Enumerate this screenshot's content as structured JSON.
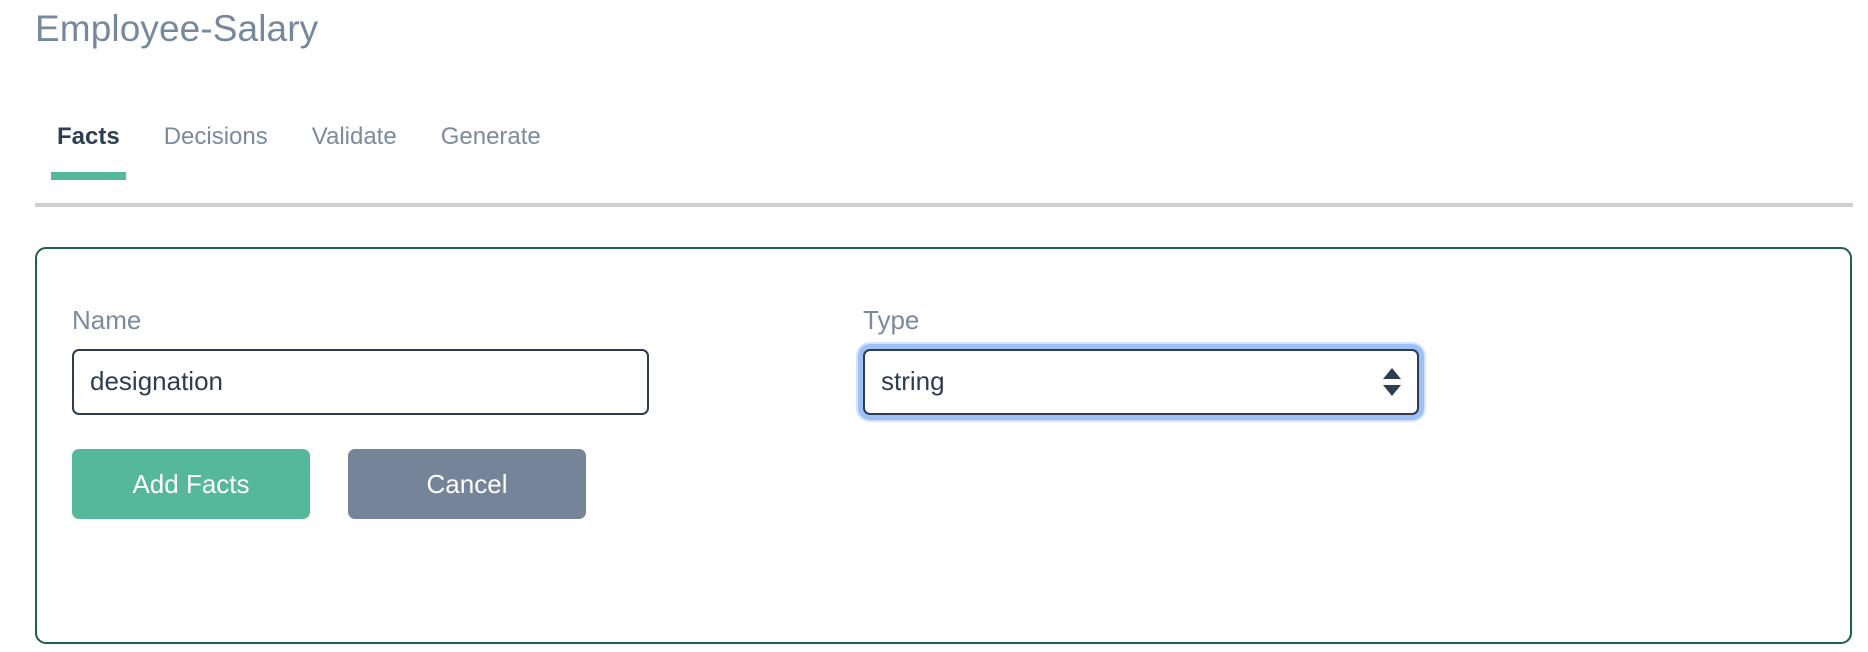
{
  "header": {
    "title": "Employee-Salary"
  },
  "tabs": {
    "items": [
      {
        "label": "Facts",
        "active": true
      },
      {
        "label": "Decisions",
        "active": false
      },
      {
        "label": "Validate",
        "active": false
      },
      {
        "label": "Generate",
        "active": false
      }
    ],
    "active_index": 0,
    "accent_color": "#56b89a",
    "divider_color": "#cfcfcf"
  },
  "form": {
    "card_border_color": "#1f6048",
    "name_field": {
      "label": "Name",
      "value": "designation",
      "placeholder": "Name"
    },
    "type_field": {
      "label": "Type",
      "value": "string",
      "focused": true,
      "focus_ring_color": "#5a96f0",
      "stepper_up_icon": "triangle-up-icon",
      "stepper_down_icon": "triangle-down-icon"
    },
    "buttons": {
      "submit_label": "Add Facts",
      "submit_color": "#56b89a",
      "cancel_label": "Cancel",
      "cancel_color": "#76849a"
    }
  }
}
